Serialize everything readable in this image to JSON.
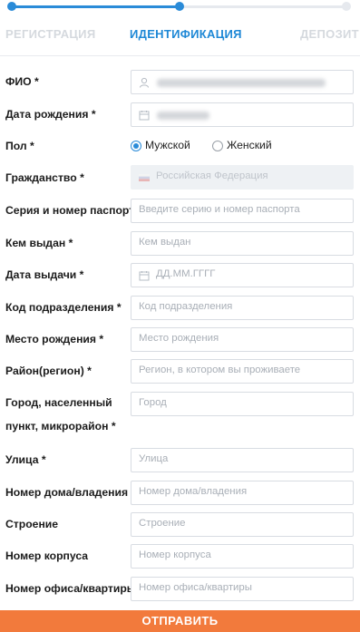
{
  "steps": [
    {
      "label": "РЕГИСТРАЦИЯ",
      "state": "done"
    },
    {
      "label": "ИДЕНТИФИКАЦИЯ",
      "state": "active"
    },
    {
      "label": "ДЕПОЗИТ",
      "state": "pending"
    }
  ],
  "progress": {
    "completed_fraction": 0.5
  },
  "colors": {
    "accent": "#2a8bd8",
    "submit": "#f27a3c"
  },
  "form": {
    "fio": {
      "label": "ФИО *",
      "icon": "user-icon"
    },
    "birth_date": {
      "label": "Дата рождения *",
      "icon": "calendar-icon"
    },
    "gender": {
      "label": "Пол *",
      "options": [
        "Мужской",
        "Женский"
      ],
      "selected": "Мужской"
    },
    "citizenship": {
      "label": "Гражданство *",
      "value": "Российская Федерация",
      "icon": "russian-flag-icon"
    },
    "passport_number": {
      "label": "Серия и номер паспорта",
      "placeholder": "Введите серию и номер паспорта"
    },
    "issued_by": {
      "label": "Кем выдан *",
      "placeholder": "Кем выдан"
    },
    "issue_date": {
      "label": "Дата выдачи *",
      "placeholder": "ДД.ММ.ГГГГ",
      "icon": "calendar-icon"
    },
    "division_code": {
      "label": "Код подразделения *",
      "placeholder": "Код подразделения"
    },
    "birth_place": {
      "label": "Место рождения *",
      "placeholder": "Место рождения"
    },
    "region": {
      "label": "Район(регион) *",
      "placeholder": "Регион, в котором вы проживаете"
    },
    "city": {
      "label_line1": "Город, населенный",
      "label_line2": "пункт, микрорайон *",
      "placeholder": "Город"
    },
    "street": {
      "label": "Улица *",
      "placeholder": "Улица"
    },
    "house": {
      "label": "Номер дома/владения *",
      "placeholder": "Номер дома/владения"
    },
    "building": {
      "label": "Строение",
      "placeholder": "Строение"
    },
    "block": {
      "label": "Номер корпуса",
      "placeholder": "Номер корпуса"
    },
    "apartment": {
      "label": "Номер офиса/квартиры",
      "placeholder": "Номер офиса/квартиры"
    }
  },
  "submit": {
    "label": "ОТПРАВИТЬ"
  }
}
